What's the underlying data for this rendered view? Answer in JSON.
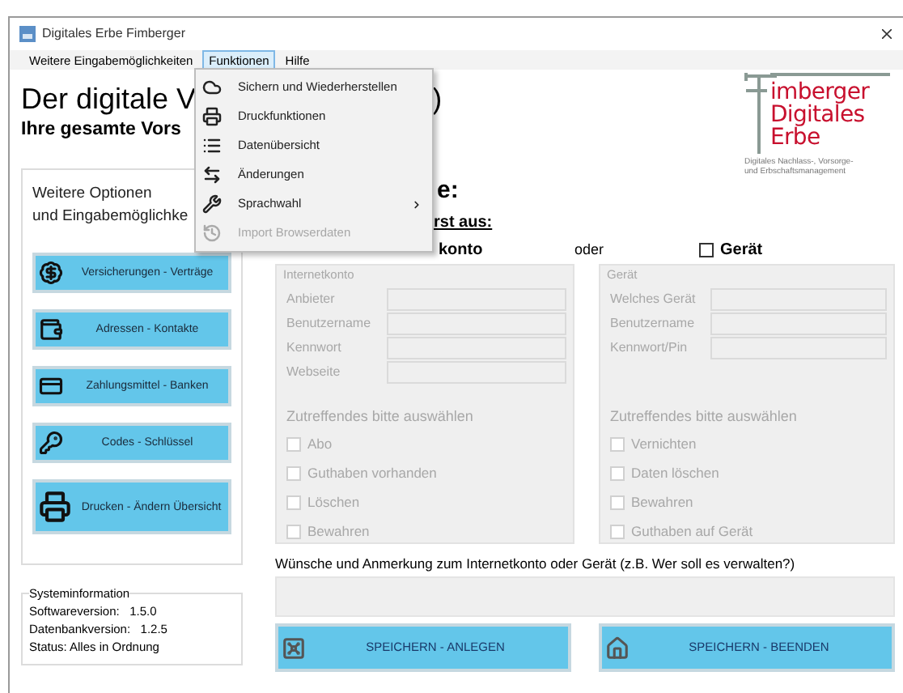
{
  "window": {
    "title": "Digitales Erbe Fimberger"
  },
  "menubar": [
    {
      "label": "Weitere Eingabemöglichkeiten",
      "selected": false
    },
    {
      "label": "Funktionen",
      "selected": true
    },
    {
      "label": "Hilfe",
      "selected": false
    }
  ],
  "open_menu": {
    "items": [
      {
        "label": "Sichern und Wiederherstellen",
        "disabled": false,
        "submenu": false
      },
      {
        "label": "Druckfunktionen",
        "disabled": false,
        "submenu": false
      },
      {
        "label": "Datenübersicht",
        "disabled": false,
        "submenu": false
      },
      {
        "label": "Änderungen",
        "disabled": false,
        "submenu": false
      },
      {
        "label": "Sprachwahl",
        "disabled": false,
        "submenu": true
      },
      {
        "label": "Import Browserdaten",
        "disabled": true,
        "submenu": false
      }
    ]
  },
  "heading": {
    "title_start": "Der digitale V",
    "title_end": ")",
    "subtitle": "Ihre gesamte Vors"
  },
  "logo": {
    "lines": [
      "imberger",
      "Digitales",
      "Erbe"
    ],
    "tagline": [
      "Digitales Nachlass-, Vorsorge-",
      "und Erbschaftsmanagement"
    ]
  },
  "options_panel": {
    "title_lines": [
      "Weitere Optionen",
      "und Eingabemöglichke"
    ],
    "buttons": [
      {
        "label": "Versicherungen - Verträge"
      },
      {
        "label": "Adressen - Kontakte"
      },
      {
        "label": "Zahlungsmittel - Banken"
      },
      {
        "label": "Codes - Schlüssel"
      },
      {
        "label": "Drucken - Ändern Übersicht"
      }
    ]
  },
  "system_info": {
    "title": "Systeminformation",
    "lines": [
      "Softwareversion:   1.5.0",
      "Datenbankversion:   1.2.5",
      "Status: Alles in Ordnung"
    ]
  },
  "form": {
    "heading_end": "e:",
    "choose_end": "rst aus:",
    "internet_label_end": "konto",
    "or": "oder",
    "device_choice": {
      "label": "Gerät",
      "checked": false
    },
    "groups": [
      {
        "title": "Internetkonto",
        "disabled": true,
        "fields": [
          "Anbieter",
          "Benutzername",
          "Kennwort",
          "Webseite"
        ],
        "options_title": "Zutreffendes bitte auswählen",
        "options": [
          {
            "label": "Abo",
            "checked": false
          },
          {
            "label": "Guthaben vorhanden",
            "checked": false
          },
          {
            "label": "Löschen",
            "checked": false
          },
          {
            "label": "Bewahren",
            "checked": false
          }
        ]
      },
      {
        "title": "Gerät",
        "disabled": true,
        "fields": [
          "Welches Gerät",
          "Benutzername",
          "Kennwort/Pin"
        ],
        "options_title": "Zutreffendes bitte auswählen",
        "options": [
          {
            "label": "Vernichten",
            "checked": false
          },
          {
            "label": "Daten löschen",
            "checked": false
          },
          {
            "label": "Bewahren",
            "checked": false
          },
          {
            "label": "Guthaben auf Gerät",
            "checked": false
          }
        ]
      }
    ],
    "remarks_label": "Wünsche und Anmerkung zum Internetkonto oder Gerät (z.B. Wer soll es verwalten?)",
    "buttons": [
      {
        "label": "SPEICHERN - ANLEGEN"
      },
      {
        "label": "SPEICHERN - BEENDEN"
      }
    ]
  }
}
